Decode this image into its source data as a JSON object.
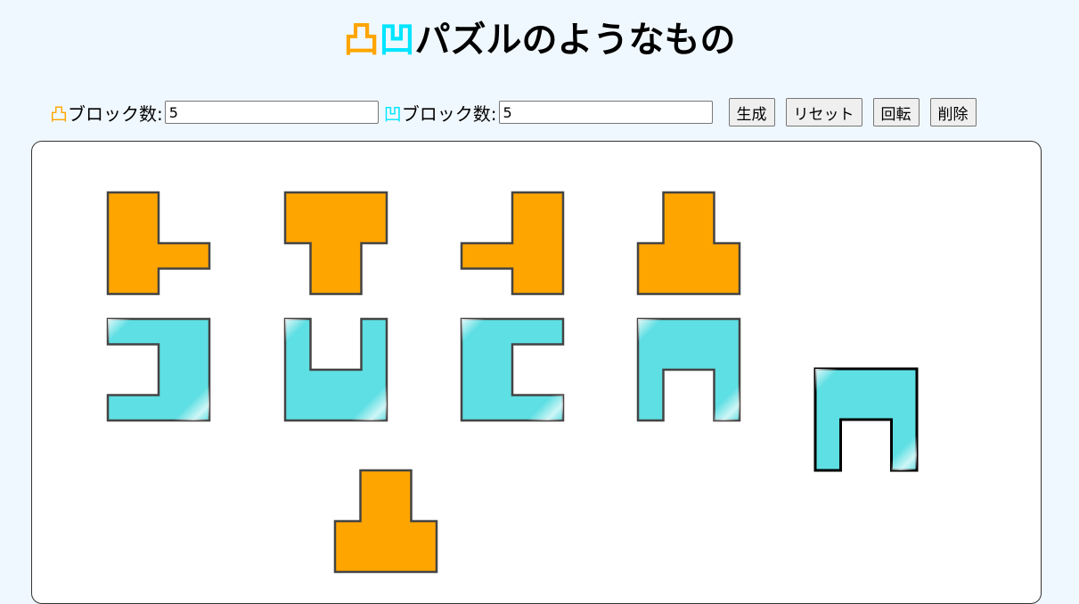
{
  "title": {
    "totsu_char": "凸",
    "ou_char": "凹",
    "text": "パズルのようなもの"
  },
  "controls": {
    "totsu_symbol": "凸",
    "totsu_label": "ブロック数:",
    "totsu_count": "5",
    "ou_symbol": "凹",
    "ou_label": "ブロック数:",
    "ou_count": "5",
    "generate_label": "生成",
    "reset_label": "リセット",
    "rotate_label": "回転",
    "delete_label": "削除"
  },
  "colors": {
    "totsu": "#ffa500",
    "ou": "#5edfe3",
    "outline": "#444444",
    "selected_outline": "#000000"
  },
  "pieces": [
    {
      "name": "totsu-piece-1",
      "type": "totsu",
      "shape": "right-arm"
    },
    {
      "name": "totsu-piece-2",
      "type": "totsu",
      "shape": "down-stem"
    },
    {
      "name": "totsu-piece-3",
      "type": "totsu",
      "shape": "left-arm"
    },
    {
      "name": "totsu-piece-4",
      "type": "totsu",
      "shape": "up-stem"
    },
    {
      "name": "ou-piece-1",
      "type": "ou",
      "shape": "left-notch"
    },
    {
      "name": "ou-piece-2",
      "type": "ou",
      "shape": "up-notch"
    },
    {
      "name": "ou-piece-3",
      "type": "ou",
      "shape": "right-notch"
    },
    {
      "name": "ou-piece-4",
      "type": "ou",
      "shape": "down-notch"
    },
    {
      "name": "ou-piece-5",
      "type": "ou",
      "shape": "down-notch",
      "selected": true
    },
    {
      "name": "totsu-piece-5",
      "type": "totsu",
      "shape": "up-stem"
    }
  ]
}
